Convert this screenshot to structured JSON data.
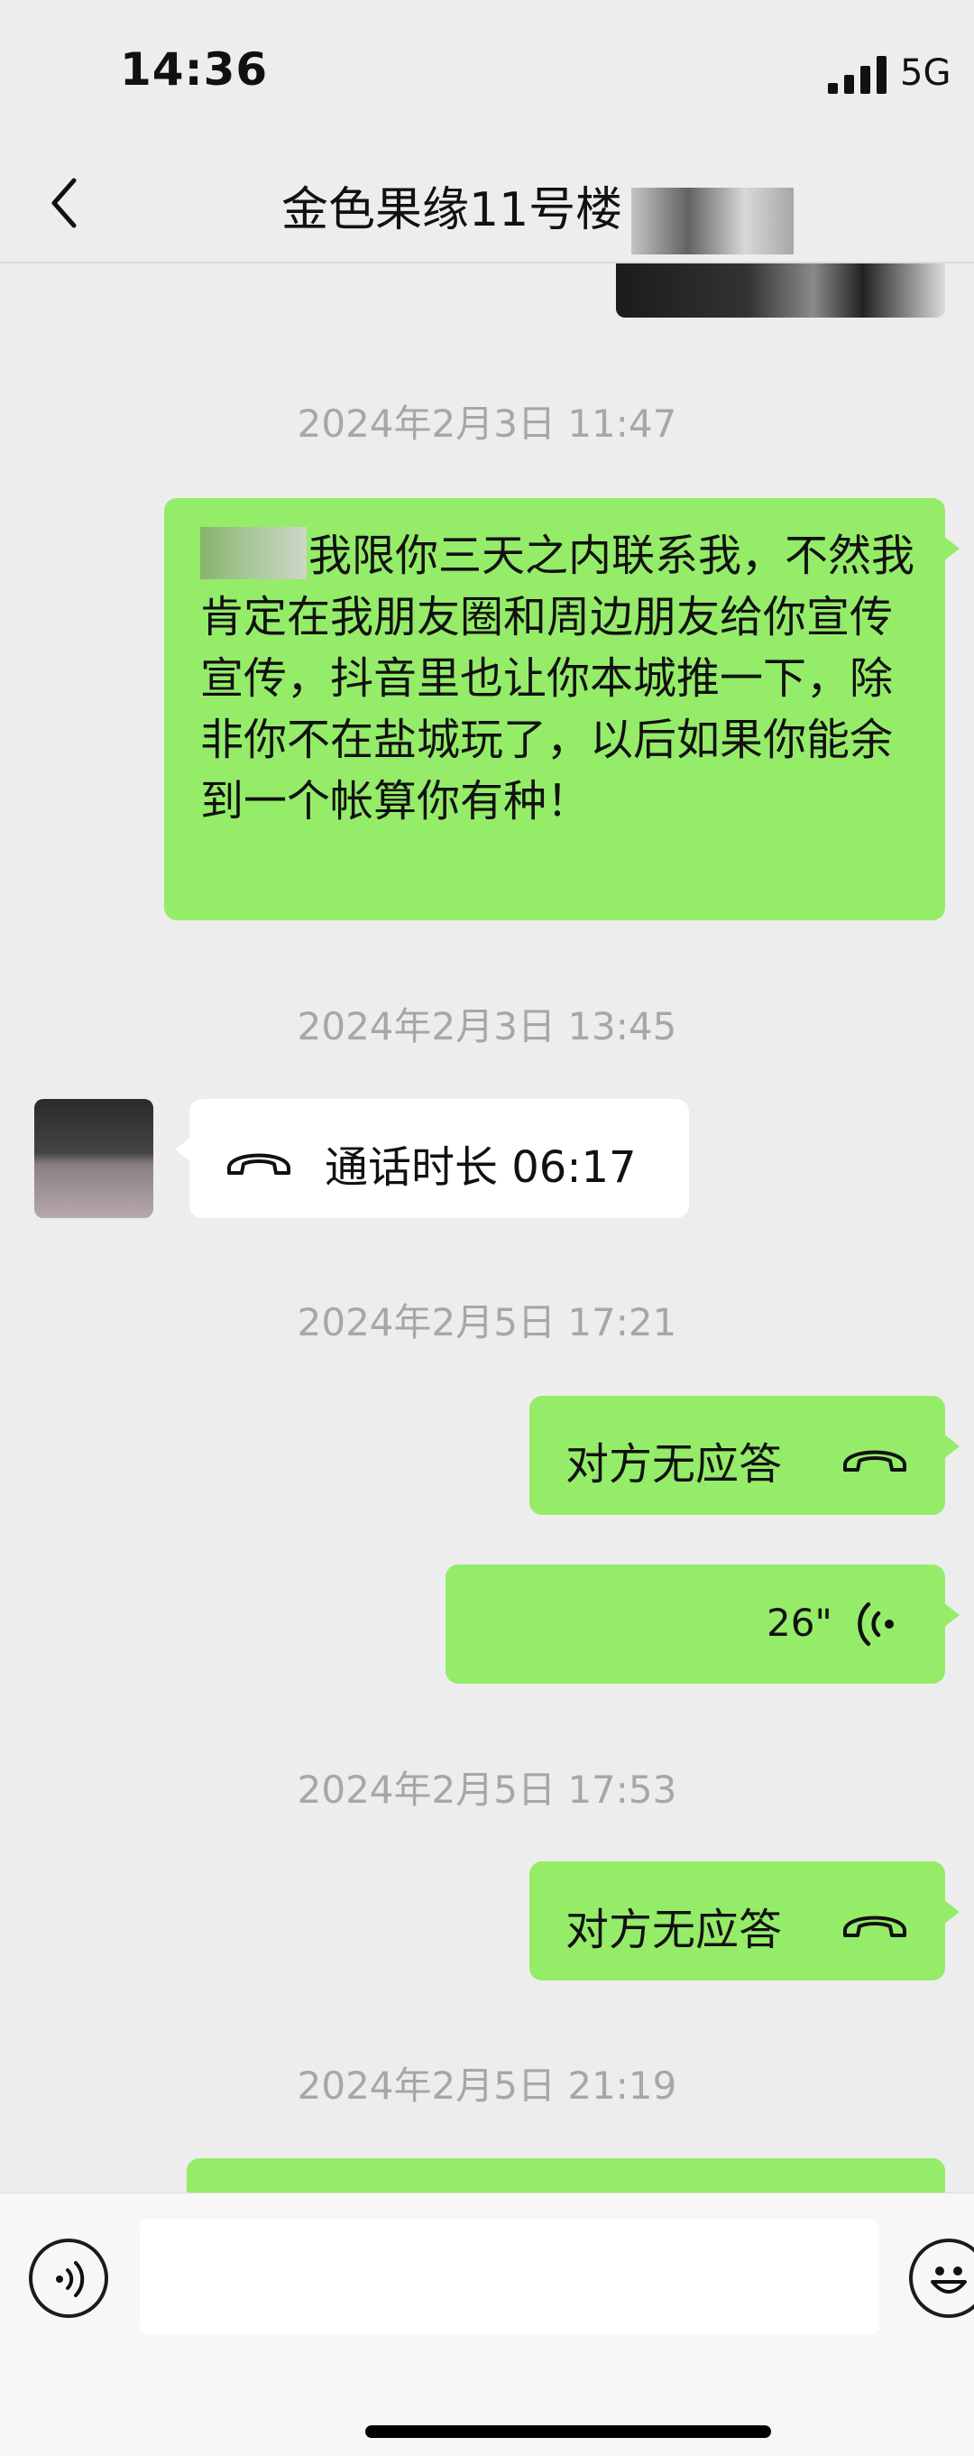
{
  "status_bar": {
    "time": "14:36",
    "network": "5G"
  },
  "nav": {
    "title": "金色果缘11号楼"
  },
  "messages": [
    {
      "id": "ts1",
      "timestamp": "2024年2月3日 11:47"
    },
    {
      "id": "m1",
      "text": "我限你三天之内联系我，不然我肯定在我朋友圈和周边朋友给你宣传宣传，抖音里也让你本城推一下，除非你不在盐城玩了，以后如果你能余到一个帐算你有种！"
    },
    {
      "id": "ts2",
      "timestamp": "2024年2月3日 13:45"
    },
    {
      "id": "m2",
      "text": "通话时长 06:17"
    },
    {
      "id": "ts3",
      "timestamp": "2024年2月5日 17:21"
    },
    {
      "id": "m3",
      "text": "对方无应答"
    },
    {
      "id": "m4",
      "duration": "26\""
    },
    {
      "id": "ts4",
      "timestamp": "2024年2月5日 17:53"
    },
    {
      "id": "m5",
      "text": "对方无应答"
    },
    {
      "id": "ts5",
      "timestamp": "2024年2月5日 21:19"
    }
  ],
  "input": {
    "value": "",
    "placeholder": ""
  },
  "icons": {
    "back": "back-chevron-icon",
    "signal": "signal-bars-icon",
    "phone": "phone-handset-icon",
    "voice_wave": "voice-wave-icon",
    "voice_mode": "voice-mode-icon",
    "emoji": "emoji-face-icon"
  },
  "colors": {
    "bubble_sent": "#95ec69",
    "bubble_received": "#ffffff",
    "background": "#ededed"
  }
}
